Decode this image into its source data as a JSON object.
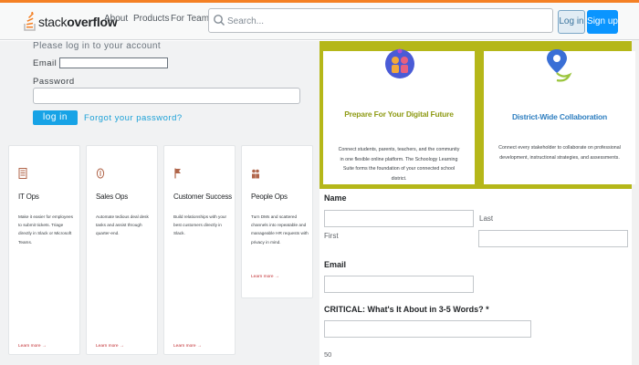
{
  "header": {
    "logo": {
      "word_stack": "stack",
      "word_overflow": "overflow"
    },
    "nav": {
      "about": "About",
      "products": "Products",
      "teams": "For Teams"
    },
    "search_placeholder": "Search...",
    "login": "Log in",
    "signup": "Sign up"
  },
  "login": {
    "caption": "Please log in to your account",
    "email_label": "Email",
    "email_value": "",
    "password_label": "Password",
    "password_value": "",
    "submit": "log in",
    "forgot": "Forgot your password?"
  },
  "cards": [
    {
      "title": "IT Ops",
      "icon": "document-icon",
      "desc": "Make it easier for employees to submit tickets. Triage directly in Slack or Microsoft Teams.",
      "link": "Learn more →"
    },
    {
      "title": "Sales Ops",
      "icon": "coin-icon",
      "desc": "Automate tedious deal desk tasks and assist through quarter-end.",
      "link": "Learn more →"
    },
    {
      "title": "Customer Success",
      "icon": "flag-icon",
      "desc": "Build relationships with your best customers directly in Slack.",
      "link": "Learn more →"
    },
    {
      "title": "People Ops",
      "icon": "people-icon",
      "desc": "Turn DMs and scattered channels into repeatable and manageable HR requests with privacy in mind.",
      "link": "Learn more →"
    }
  ],
  "features": [
    {
      "title": "Prepare For Your Digital Future",
      "title_color": "#8f9b16",
      "icon": "people-circle-icon",
      "desc": "Connect students, parents, teachers, and the community in one flexible online platform. The Schoology Learning Suite forms the foundation of your connected school district."
    },
    {
      "title": "District-Wide Collaboration",
      "title_color": "#2f7fc0",
      "icon": "map-pin-icon",
      "desc": "Connect every stakeholder to collaborate on professional development, instructional strategies, and assessments."
    }
  ],
  "form": {
    "name_label": "Name",
    "first_label": "First",
    "first_value": "",
    "last_label": "Last",
    "last_value": "",
    "email_label": "Email",
    "email_value": "",
    "critical_label": "CRITICAL: What's It About in 3-5 Words? *",
    "critical_value": "",
    "char_count": "50"
  },
  "colors": {
    "brand_orange": "#f48024",
    "primary_blue": "#0a95ff",
    "banner_olive": "#b5b719",
    "link_red": "#c22e32"
  }
}
